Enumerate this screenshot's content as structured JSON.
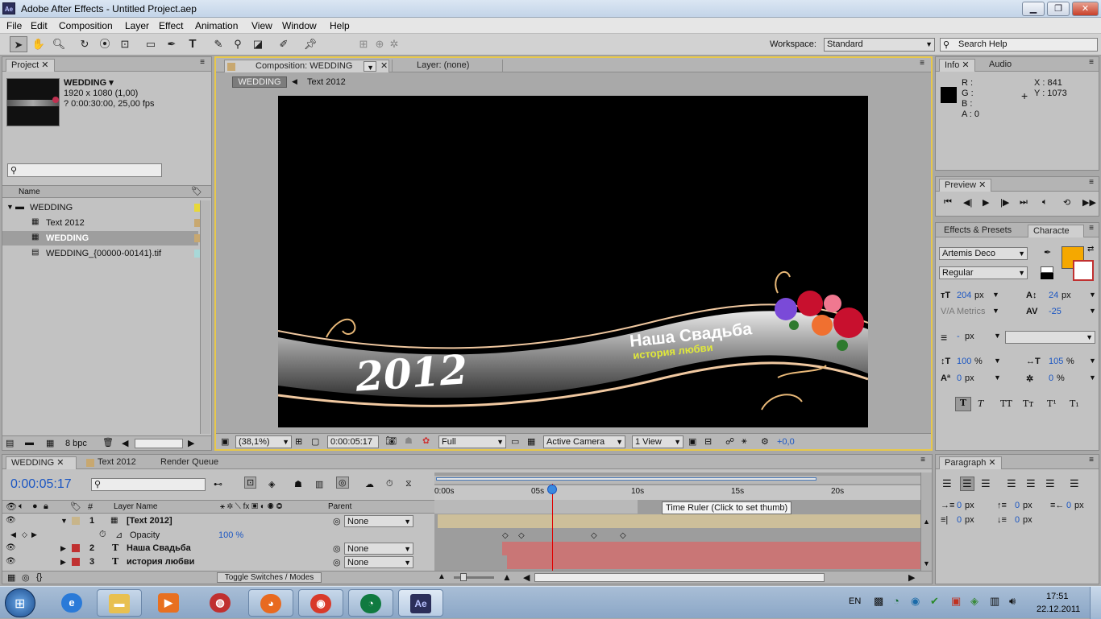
{
  "title": "Adobe After Effects - Untitled Project.aep",
  "app_icon": "Ae",
  "menu": [
    "File",
    "Edit",
    "Composition",
    "Layer",
    "Effect",
    "Animation",
    "View",
    "Window",
    "Help"
  ],
  "workspace": {
    "label": "Workspace:",
    "value": "Standard"
  },
  "search_help": {
    "placeholder": "Search Help"
  },
  "project": {
    "tab": "Project",
    "comp_name": "WEDDING ▾",
    "comp_info1": "1920 x 1080 (1,00)",
    "comp_info2": "? 0:00:30:00, 25,00 fps",
    "col_name": "Name",
    "folder": "WEDDING",
    "items": [
      "Text  2012",
      "WEDDING",
      "WEDDING_{00000-00141}.tif"
    ],
    "bpc": "8 bpc"
  },
  "comp_panel": {
    "tab": "Composition: WEDDING",
    "layer_tab": "Layer: (none)",
    "crumb1": "WEDDING",
    "crumb2": "Text  2012",
    "zoom": "(38,1%)",
    "time": "0:00:05:17",
    "resolution": "Full",
    "camera": "Active Camera",
    "views": "1 View",
    "offset": "+0,0",
    "art_year": "2012",
    "art_line1": "Наша Свадьба",
    "art_line2": "история любви"
  },
  "info": {
    "tab": "Info",
    "tab2": "Audio",
    "r": "R :",
    "g": "G :",
    "b": "B :",
    "a": "A : 0",
    "x": "X : 841",
    "y": "Y : 1073"
  },
  "preview": {
    "tab": "Preview"
  },
  "character": {
    "tab1": "Effects & Presets",
    "tab2": "Characte",
    "font": "Artemis Deco",
    "style": "Regular",
    "size": "204",
    "size_unit": "px",
    "leading": "24",
    "leading_unit": "px",
    "kerning": "Metrics",
    "tracking": "-25",
    "stroke": "-",
    "stroke_unit": "px",
    "vscale": "100",
    "hscale": "105",
    "pct": "%",
    "baseline": "0",
    "tsume": "0",
    "fill_color": "#f5a800",
    "styles": [
      "T",
      "T",
      "TT",
      "Tт",
      "T¹",
      "T₁"
    ]
  },
  "paragraph": {
    "tab": "Paragraph",
    "vals": [
      "0",
      "0",
      "0",
      "0",
      "0"
    ],
    "unit": "px"
  },
  "timeline": {
    "tabs": [
      "WEDDING",
      "Text  2012",
      "Render Queue"
    ],
    "time": "0:00:05:17",
    "ruler": [
      "0:00s",
      "05s",
      "10s",
      "15s",
      "20s"
    ],
    "tooltip": "Time Ruler (Click to set thumb)",
    "col_layer": "Layer Name",
    "col_parent": "Parent",
    "layers": [
      {
        "num": "1",
        "name": "[Text  2012]",
        "parent": "None",
        "color": "#c8b58a"
      },
      {
        "num": "2",
        "name": "Наша Свадьба",
        "parent": "None",
        "color": "#c03030"
      },
      {
        "num": "3",
        "name": "история любви",
        "parent": "None",
        "color": "#c03030"
      }
    ],
    "opacity_label": "Opacity",
    "opacity_val": "100 %",
    "toggle": "Toggle Switches / Modes"
  },
  "taskbar": {
    "lang": "EN",
    "time": "17:51",
    "date": "22.12.2011"
  }
}
